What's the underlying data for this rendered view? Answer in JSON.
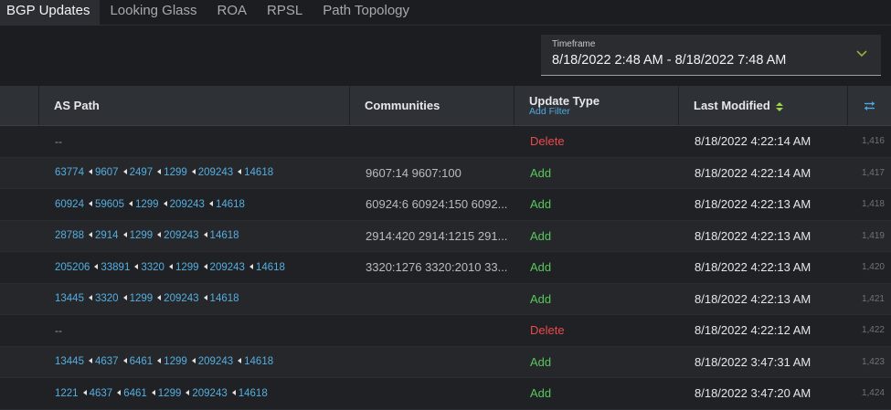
{
  "tabs": [
    "BGP Updates",
    "Looking Glass",
    "ROA",
    "RPSL",
    "Path Topology"
  ],
  "active_tab": 0,
  "timeframe": {
    "label": "Timeframe",
    "value": "8/18/2022 2:48 AM - 8/18/2022 7:48 AM",
    "chevron_icon": "chevron-down-icon",
    "chevron_color": "#8fae3b"
  },
  "columns": {
    "as_path": "AS Path",
    "communities": "Communities",
    "update_type": "Update Type",
    "add_filter": "Add Filter",
    "last_modified": "Last Modified",
    "sort_icon": "sort-icon",
    "settings_icon": "column-settings-icon"
  },
  "colors": {
    "accent": "#4fa7e0",
    "add": "#58c75c",
    "delete": "#ea4a4f",
    "sort": "#9fd14b"
  },
  "rows": [
    {
      "as_path": [],
      "empty_text": "--",
      "communities": "",
      "update_type": "Delete",
      "last_modified": "8/18/2022 4:22:14 AM",
      "index": "1,416"
    },
    {
      "as_path": [
        "63774",
        "9607",
        "2497",
        "1299",
        "209243",
        "14618"
      ],
      "communities": "9607:14 9607:100",
      "update_type": "Add",
      "last_modified": "8/18/2022 4:22:14 AM",
      "index": "1,417"
    },
    {
      "as_path": [
        "60924",
        "59605",
        "1299",
        "209243",
        "14618"
      ],
      "communities": "60924:6 60924:150 6092...",
      "update_type": "Add",
      "last_modified": "8/18/2022 4:22:13 AM",
      "index": "1,418"
    },
    {
      "as_path": [
        "28788",
        "2914",
        "1299",
        "209243",
        "14618"
      ],
      "communities": "2914:420 2914:1215 291...",
      "update_type": "Add",
      "last_modified": "8/18/2022 4:22:13 AM",
      "index": "1,419"
    },
    {
      "as_path": [
        "205206",
        "33891",
        "3320",
        "1299",
        "209243",
        "14618"
      ],
      "communities": "3320:1276 3320:2010 33...",
      "update_type": "Add",
      "last_modified": "8/18/2022 4:22:13 AM",
      "index": "1,420"
    },
    {
      "as_path": [
        "13445",
        "3320",
        "1299",
        "209243",
        "14618"
      ],
      "communities": "",
      "update_type": "Add",
      "last_modified": "8/18/2022 4:22:13 AM",
      "index": "1,421"
    },
    {
      "as_path": [],
      "empty_text": "--",
      "communities": "",
      "update_type": "Delete",
      "last_modified": "8/18/2022 4:22:12 AM",
      "index": "1,422"
    },
    {
      "as_path": [
        "13445",
        "4637",
        "6461",
        "1299",
        "209243",
        "14618"
      ],
      "communities": "",
      "update_type": "Add",
      "last_modified": "8/18/2022 3:47:31 AM",
      "index": "1,423"
    },
    {
      "as_path": [
        "1221",
        "4637",
        "6461",
        "1299",
        "209243",
        "14618"
      ],
      "communities": "",
      "update_type": "Add",
      "last_modified": "8/18/2022 3:47:20 AM",
      "index": "1,424"
    }
  ]
}
